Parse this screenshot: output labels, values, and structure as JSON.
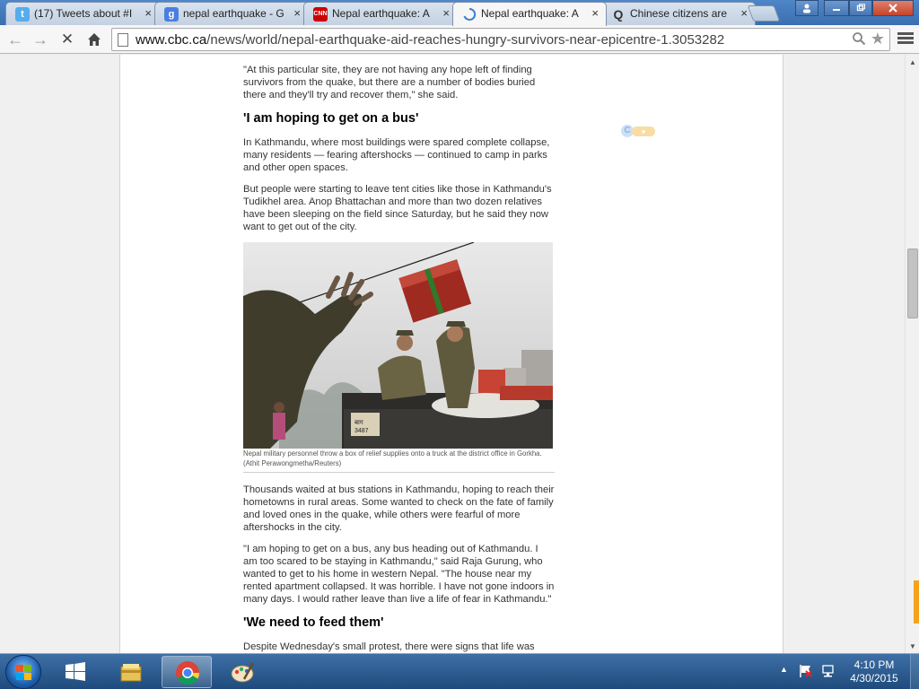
{
  "browser": {
    "tabs": [
      {
        "title": "(17) Tweets about #I",
        "icon": "twitter-icon",
        "close": "×",
        "active": false
      },
      {
        "title": "nepal earthquake - G",
        "icon": "google-icon",
        "close": "×",
        "active": false
      },
      {
        "title": "Nepal earthquake: A",
        "icon": "cnn-icon",
        "close": "×",
        "active": false
      },
      {
        "title": "Nepal earthquake: A",
        "icon": "loading-spinner-icon",
        "close": "×",
        "active": true
      },
      {
        "title": "Chinese citizens are",
        "icon": "quora-icon",
        "close": "×",
        "active": false
      }
    ],
    "url": {
      "host": "www.cbc.ca",
      "path": "/news/world/nepal-earthquake-aid-reaches-hungry-survivors-near-epicentre-1.3053282"
    },
    "icons": {
      "back": "←",
      "forward": "→",
      "stop": "✕",
      "home": "⌂",
      "zoom": "⚲",
      "star": "★"
    }
  },
  "article": {
    "p_intro": "\"At this particular site, they are not having any hope left of finding survivors from the quake, but there are a number of bodies buried there and they'll try and recover them,\" she said.",
    "h_bus": "'I am hoping to get on a bus'",
    "p_kathmandu": "In Kathmandu, where most buildings were spared complete collapse, many residents — fearing aftershocks — continued to camp in parks and other open spaces.",
    "p_tents": "But people were starting to leave tent cities like those in Kathmandu's Tudikhel area. Anop Bhattachan and more than two dozen relatives have been sleeping on the field since Saturday, but he said they now want to get out of the city.",
    "photo_caption": "Nepal military personnel throw a box of relief supplies onto a truck at the district office in Gorkha. (Athit Perawongmetha/Reuters)",
    "p_bus_stations": "Thousands waited at bus stations in Kathmandu, hoping to reach their hometowns in rural areas. Some wanted to check on the fate of family and loved ones in the quake, while others were fearful of more aftershocks in the city.",
    "p_quote": "\"I am hoping to get on a bus, any bus heading out of Kathmandu. I am too scared to be staying in Kathmandu,\" said Raja Gurung, who wanted to get to his home in western Nepal. \"The house near my rented apartment collapsed. It was horrible. I have not gone indoors in many days. I would rather leave than live a life of fear in Kathmandu.\"",
    "h_feed": "'We need to feed them'",
    "p_protest": "Despite Wednesday's small protest, there were signs that life was inching back to normal in the capital. Banks opened for a few hours and refilled"
  },
  "taskbar": {
    "clock_time": "4:10 PM",
    "clock_date": "4/30/2015",
    "items": [
      "windows-explorer-icon",
      "file-manager-icon",
      "chrome-icon",
      "paint-icon"
    ]
  },
  "colors": {
    "tab_strip": "#3a6fb0",
    "taskbar": "#2a5a8f",
    "scroll_marker": "#f7a21b"
  }
}
